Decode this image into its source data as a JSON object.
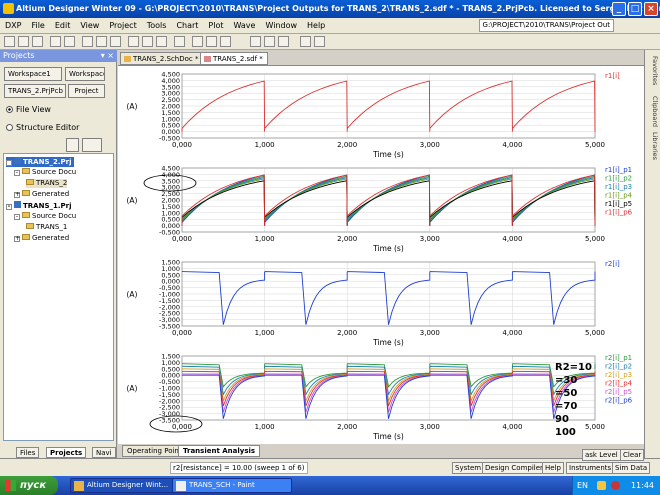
{
  "window": {
    "title": "Altium Designer Winter 09 - G:\\PROJECT\\2010\\TRANS\\Project Outputs for TRANS_2\\TRANS_2.sdf * - TRANS_2.PrjPcb. Licensed to Serge. Not signe..."
  },
  "menu": {
    "items": [
      "DXP",
      "File",
      "Edit",
      "View",
      "Project",
      "Tools",
      "Chart",
      "Plot",
      "Wave",
      "Window",
      "Help"
    ],
    "path": "G:\\PROJECT\\2010\\TRANS\\Project Out"
  },
  "projects_panel": {
    "title": "Projects",
    "workspace_select": "Workspace1",
    "workspace_button": "Workspace",
    "project_select": "TRANS_2.PrjPcb",
    "project_button": "Project",
    "file_view": "File View",
    "structure_editor": "Structure Editor",
    "tree": [
      "TRANS_2.Prj",
      "Source Docu",
      "TRANS_2",
      "Generated",
      "TRANS_1.Prj",
      "Source Docu",
      "TRANS_1",
      "Generated"
    ],
    "tabs": [
      "Files",
      "Projects",
      "Navi"
    ]
  },
  "doc_tabs": [
    "TRANS_2.SchDoc *",
    "TRANS_2.sdf *"
  ],
  "right_tabs": [
    "Favorites",
    "Clipboard",
    "Libraries"
  ],
  "bottom_tabs": [
    "Operating Point",
    "Transient Analysis"
  ],
  "status": {
    "sweep": "r2[resistance] = 10.00  (sweep 1 of 6)",
    "buttons": [
      "System",
      "Design Compiler",
      "Help",
      "Instruments",
      "Sim Data"
    ],
    "mask": "ask Level",
    "clear": "Clear"
  },
  "taskbar": {
    "start": "пуск",
    "tasks": [
      "Altium Designer Wint...",
      "TRANS_SCH - Paint"
    ],
    "lang": "EN",
    "time": "11:44"
  },
  "chart_data": [
    {
      "type": "line",
      "xlabel": "Time (s)",
      "ylabel": "(A)",
      "xlim": [
        0,
        5.0
      ],
      "xticks": [
        "0,000",
        "1,000",
        "2,000",
        "3,000",
        "4,000",
        "5,000"
      ],
      "yticks": [
        "4,500",
        "4,000",
        "3,500",
        "3,000",
        "2,500",
        "2,000",
        "1,500",
        "1,000",
        "0,500",
        "0,000",
        "-0,500"
      ],
      "ylim": [
        -0.5,
        4.5
      ],
      "series": [
        {
          "name": "r1[i]",
          "color": "#e03030",
          "shape": "ramp",
          "peaks": [
            3.95
          ]
        }
      ]
    },
    {
      "type": "line",
      "xlabel": "Time (s)",
      "ylabel": "(A)",
      "xlim": [
        0,
        5.0
      ],
      "xticks": [
        "0,000",
        "1,000",
        "2,000",
        "3,000",
        "4,000",
        "5,000"
      ],
      "yticks": [
        "4,500",
        "4,000",
        "3,500",
        "3,000",
        "2,500",
        "2,000",
        "1,500",
        "1,000",
        "0,500",
        "0,000",
        "-0,500"
      ],
      "ylim": [
        -0.5,
        4.5
      ],
      "series": [
        {
          "name": "r1[i]_p1",
          "color": "#1f3fd0",
          "shape": "ramp",
          "peaks": [
            3.95
          ]
        },
        {
          "name": "r1[i]_p2",
          "color": "#2a9a3a",
          "shape": "ramp",
          "peaks": [
            3.85
          ]
        },
        {
          "name": "r1[i]_p3",
          "color": "#1a7fb0",
          "shape": "ramp",
          "peaks": [
            3.75
          ]
        },
        {
          "name": "r1[i]_p4",
          "color": "#6a9a20",
          "shape": "ramp",
          "peaks": [
            3.65
          ]
        },
        {
          "name": "r1[i]_p5",
          "color": "#000000",
          "shape": "ramp",
          "peaks": [
            3.5
          ]
        },
        {
          "name": "r1[i]_p6",
          "color": "#e03030",
          "shape": "ramp",
          "peaks": [
            3.95
          ]
        }
      ]
    },
    {
      "type": "line",
      "xlabel": "Time (s)",
      "ylabel": "(A)",
      "xlim": [
        0,
        5.0
      ],
      "xticks": [
        "0,000",
        "1,000",
        "2,000",
        "3,000",
        "4,000",
        "5,000"
      ],
      "yticks": [
        "1,500",
        "1,000",
        "0,500",
        "0,000",
        "-0,500",
        "-1,000",
        "-1,500",
        "-2,000",
        "-2,500",
        "-3,000",
        "-3,500"
      ],
      "ylim": [
        -3.5,
        1.5
      ],
      "series": [
        {
          "name": "r2[i]",
          "color": "#1f3fd0",
          "shape": "decay",
          "peak": 0.75,
          "trough": -3.4
        }
      ]
    },
    {
      "type": "line",
      "xlabel": "Time (s)",
      "ylabel": "(A)",
      "xlim": [
        0,
        5.0
      ],
      "xticks": [
        "0,000",
        "1,000",
        "2,000",
        "3,000",
        "4,000",
        "5,000"
      ],
      "yticks": [
        "1,500",
        "1,000",
        "0,500",
        "0,000",
        "-0,500",
        "-1,000",
        "-1,500",
        "-2,000",
        "-2,500",
        "-3,000",
        "-3,500"
      ],
      "ylim": [
        -3.5,
        1.5
      ],
      "series": [
        {
          "name": "r2[i]_p1",
          "color": "#2a9a3a",
          "shape": "decay",
          "peak": 0.9,
          "trough": -0.9
        },
        {
          "name": "r2[i]_p2",
          "color": "#1a7fb0",
          "shape": "decay",
          "peak": 0.7,
          "trough": -1.5
        },
        {
          "name": "r2[i]_p3",
          "color": "#d0a020",
          "shape": "decay",
          "peak": 0.5,
          "trough": -2.0
        },
        {
          "name": "r2[i]_p4",
          "color": "#e03030",
          "shape": "decay",
          "peak": 0.3,
          "trough": -2.4
        },
        {
          "name": "r2[i]_p5",
          "color": "#d050d0",
          "shape": "decay",
          "peak": 0.1,
          "trough": -2.9
        },
        {
          "name": "r2[i]_p6",
          "color": "#1f3fd0",
          "shape": "decay",
          "peak": 0.0,
          "trough": -3.4
        }
      ],
      "annotation": [
        "R2=10",
        "=30",
        "=50",
        "=70",
        "90",
        "100"
      ]
    }
  ]
}
